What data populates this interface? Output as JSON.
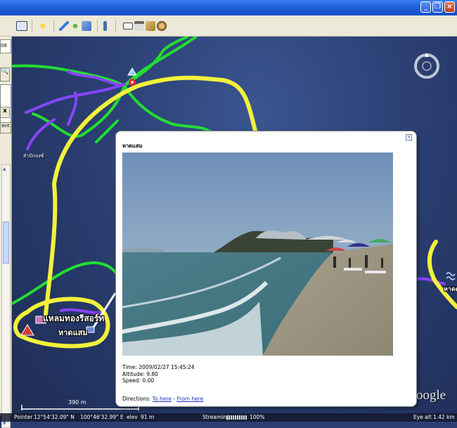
{
  "map": {
    "places": {
      "resort": "แหลมทองรีสอร์ท",
      "beach": "หาดแสม",
      "town": "ลำปักลงซ์",
      "right_edge": "หาดต"
    },
    "logo": "oogle",
    "scale": "390 m"
  },
  "popup": {
    "title": "หาดแสม",
    "time": "Time: 2009/02/27 15:45:24",
    "altitude": "Altitude: 9.80",
    "speed": "Speed: 0.00",
    "directions_label": "Directions:",
    "to_here": "To here",
    "separator": " - ",
    "from_here": "From here"
  },
  "statusbar": {
    "pointer": "Pointer",
    "lat": "12°54'32.09\" N",
    "lon": "100°46'32.99\" E",
    "elev": "elev",
    "elev_value": "91 m",
    "streaming": "Streaming",
    "percent": "100%",
    "eye_alt": "Eye alt",
    "eye_alt_value": "1.42 km"
  },
  "leftpanel": {
    "search_fragment": "08",
    "close_glyph": "x",
    "tab_fragment": "ent"
  },
  "colors": {
    "route_green": "#22dd33",
    "route_purple": "#8844ff",
    "annotation_yellow": "#f2f23a"
  }
}
